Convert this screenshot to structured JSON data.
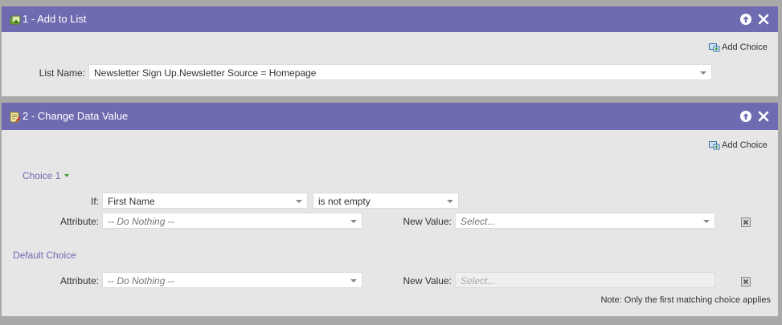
{
  "panel1": {
    "title": "1 - Add to List",
    "add_choice": "Add Choice",
    "list_name_label": "List Name:",
    "list_name_value": "Newsletter Sign Up.Newsletter Source = Homepage"
  },
  "panel2": {
    "title": "2 - Change Data Value",
    "add_choice": "Add Choice",
    "choice1": {
      "title": "Choice 1",
      "if_label": "If:",
      "if_field": "First Name",
      "if_operator": "is not empty",
      "attribute_label": "Attribute:",
      "attribute_value": "-- Do Nothing --",
      "new_value_label": "New Value:",
      "new_value_value": "Select..."
    },
    "default_choice": {
      "title": "Default Choice",
      "attribute_label": "Attribute:",
      "attribute_value": "-- Do Nothing --",
      "new_value_label": "New Value:",
      "new_value_value": "Select..."
    },
    "note": "Note: Only the first matching choice applies"
  },
  "colors": {
    "header": "#6e6bb1",
    "panel_bg": "#e6e6e6",
    "page_bg": "#a9a9a9",
    "link": "#6e6bb1"
  },
  "icons": {
    "panel1": "add-to-list-icon",
    "panel2": "change-data-value-icon",
    "move_up": "move-up-icon",
    "close": "close-icon",
    "add_choice": "add-choice-icon",
    "delete": "delete-icon"
  }
}
